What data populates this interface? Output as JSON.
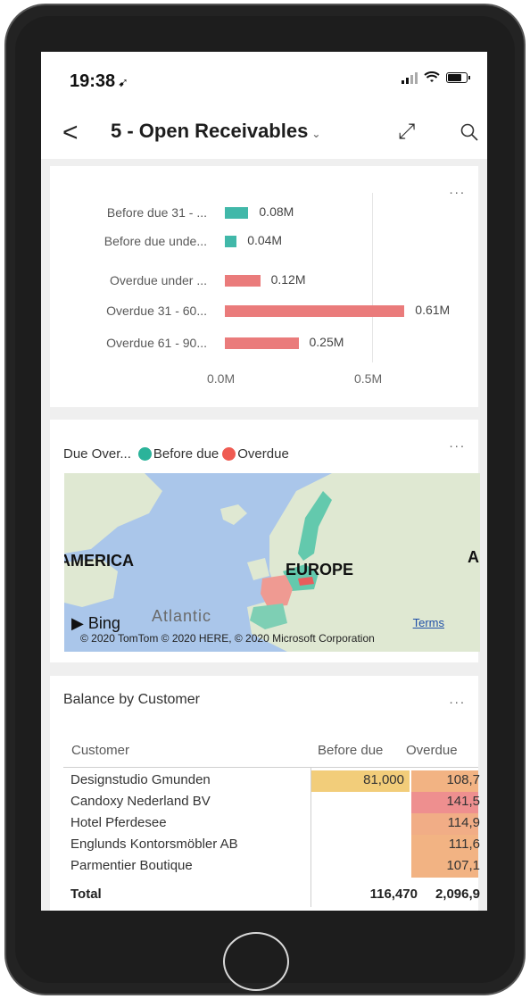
{
  "status": {
    "time": "19:38"
  },
  "header": {
    "back": "<",
    "title": "5 - Open Receivables",
    "chevron": "⌄",
    "expand": "⤢"
  },
  "menus": {
    "more": "..."
  },
  "chart_data": {
    "type": "bar",
    "orientation": "horizontal",
    "categories": [
      "Before due 31 - ...",
      "Before due unde...",
      "Overdue under ...",
      "Overdue 31 - 60...",
      "Overdue 61 - 90..."
    ],
    "values": [
      0.08,
      0.04,
      0.12,
      0.61,
      0.25
    ],
    "value_labels": [
      "0.08M",
      "0.04M",
      "0.12M",
      "0.61M",
      "0.25M"
    ],
    "colors": [
      "#41b8a9",
      "#41b8a9",
      "#ea7b7b",
      "#ea7b7b",
      "#ea7b7b"
    ],
    "x_ticks": [
      "0.0M",
      "0.5M"
    ],
    "xlim": [
      0,
      0.65
    ],
    "grid": true
  },
  "map_card": {
    "title": "Due Over...",
    "legend": [
      {
        "label": "Before due",
        "color": "#2bb39a"
      },
      {
        "label": "Overdue",
        "color": "#ef5b52"
      }
    ],
    "labels": {
      "america": "AMERICA",
      "europe": "EUROPE",
      "asia_partial": "A",
      "ocean": "Atlantic"
    },
    "bing": "Bing",
    "copyright": "© 2020 TomTom © 2020 HERE, © 2020 Microsoft Corporation",
    "terms": "Terms"
  },
  "table": {
    "title": "Balance by Customer",
    "headers": [
      "Customer",
      "Before due",
      "Overdue"
    ],
    "rows": [
      {
        "customer": "Designstudio Gmunden",
        "before_due": "81,000",
        "overdue": "108,7"
      },
      {
        "customer": "Candoxy Nederland BV",
        "before_due": "",
        "overdue": "141,5"
      },
      {
        "customer": "Hotel Pferdesee",
        "before_due": "",
        "overdue": "114,9"
      },
      {
        "customer": "Englunds Kontorsmöbler AB",
        "before_due": "",
        "overdue": "111,6"
      },
      {
        "customer": "Parmentier Boutique",
        "before_due": "",
        "overdue": "107,1"
      }
    ],
    "total": {
      "label": "Total",
      "before_due": "116,470",
      "overdue": "2,096,9"
    },
    "cell_colors": {
      "before_due_highlight": "#f2cd7a",
      "overdue": [
        "#f2b383",
        "#ee8f8f",
        "#f1ad86",
        "#f2b383",
        "#f2b383"
      ]
    }
  }
}
